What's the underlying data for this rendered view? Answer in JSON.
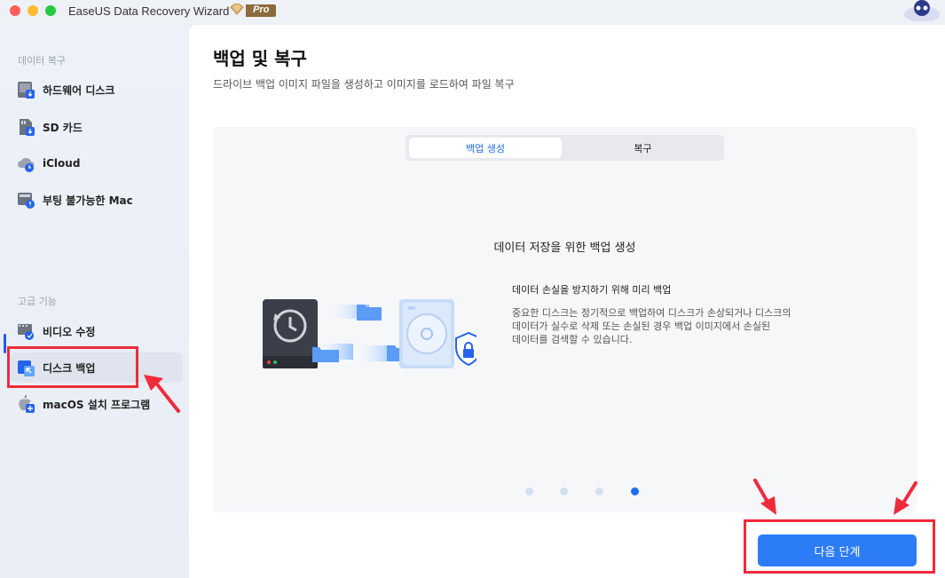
{
  "window": {
    "title": "EaseUS Data Recovery Wizard",
    "badge": "Pro"
  },
  "sidebar": {
    "section_recovery": "데이터 복구",
    "section_advanced": "고급 기능",
    "items": [
      {
        "label": "하드웨어 디스크",
        "icon": "hard-drive-icon"
      },
      {
        "label": "SD 카드",
        "icon": "sd-card-icon"
      },
      {
        "label": "iCloud",
        "icon": "icloud-icon"
      },
      {
        "label": "부팅 불가능한 Mac",
        "icon": "unbootable-mac-icon"
      },
      {
        "label": "비디오 수정",
        "icon": "video-repair-icon"
      },
      {
        "label": "디스크 백업",
        "icon": "disk-backup-icon"
      },
      {
        "label": "macOS 설치 프로그램",
        "icon": "macos-installer-icon"
      }
    ],
    "active_index": 5
  },
  "main": {
    "title": "백업 및 복구",
    "subtitle": "드라이브 백업 이미지 파일을 생성하고 이미지를 로드하여 파일 복구",
    "tabs": [
      {
        "label": "백업 생성",
        "selected": true
      },
      {
        "label": "복구",
        "selected": false
      }
    ],
    "feature_title": "데이터 저장을 위한 백업 생성",
    "desc_heading": "데이터 손실을 방지하기 위해 미리 백업",
    "desc_lines": [
      "중요한 디스크는 정기적으로 백업하여 디스크가 손상되거나 디스크의",
      "데이터가 실수로 삭제 또는 손실된 경우 백업 이미지에서 손실된",
      "데이터를 검색할 수 있습니다."
    ],
    "carousel": {
      "pages": 4,
      "current": 4
    },
    "next_button": "다음 단계"
  },
  "colors": {
    "accent": "#2d7cf7",
    "annotation_red": "#ef2b3b"
  }
}
